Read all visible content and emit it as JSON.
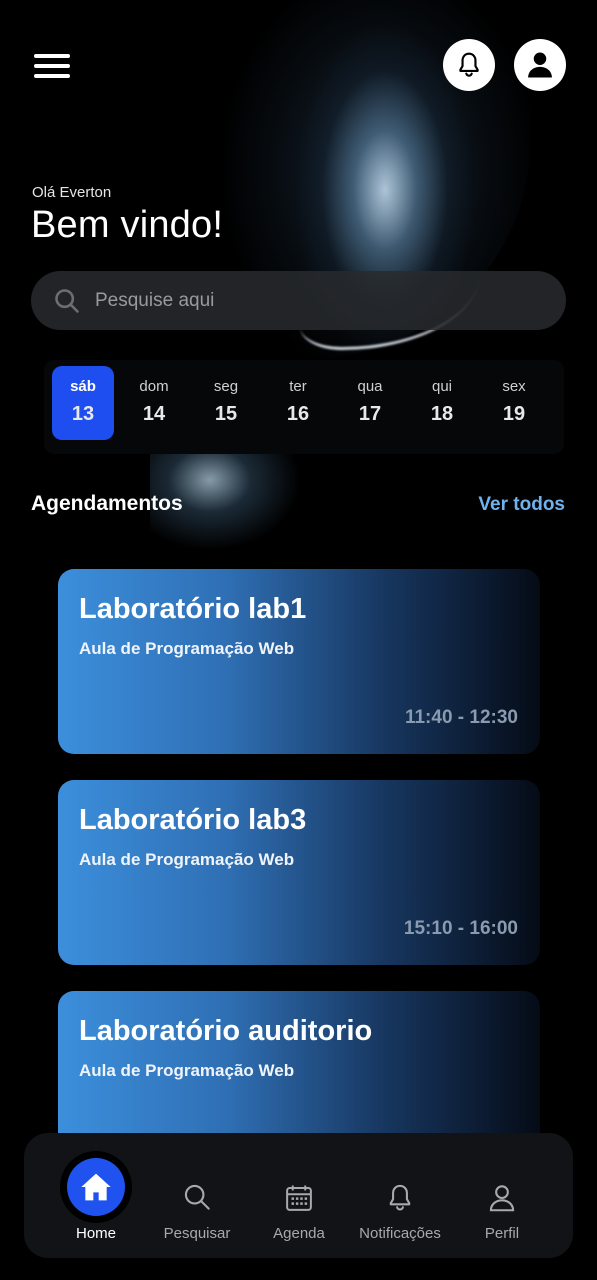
{
  "header": {
    "greeting": "Olá Everton",
    "welcome": "Bem vindo!"
  },
  "search": {
    "placeholder": "Pesquise aqui"
  },
  "calendar": {
    "days": [
      {
        "name": "sáb",
        "num": "13",
        "selected": true
      },
      {
        "name": "dom",
        "num": "14"
      },
      {
        "name": "seg",
        "num": "15"
      },
      {
        "name": "ter",
        "num": "16"
      },
      {
        "name": "qua",
        "num": "17"
      },
      {
        "name": "qui",
        "num": "18"
      },
      {
        "name": "sex",
        "num": "19"
      }
    ]
  },
  "appointments": {
    "title": "Agendamentos",
    "see_all": "Ver todos",
    "items": [
      {
        "title": "Laboratório lab1",
        "subtitle": "Aula de Programação Web",
        "time": "11:40 - 12:30"
      },
      {
        "title": "Laboratório lab3",
        "subtitle": "Aula de Programação Web",
        "time": "15:10 - 16:00"
      },
      {
        "title": "Laboratório auditorio",
        "subtitle": "Aula de Programação Web",
        "time": ""
      }
    ]
  },
  "nav": {
    "items": [
      {
        "label": "Home",
        "icon": "home-icon",
        "active": true
      },
      {
        "label": "Pesquisar",
        "icon": "search-icon"
      },
      {
        "label": "Agenda",
        "icon": "calendar-icon"
      },
      {
        "label": "Notificações",
        "icon": "bell-icon"
      },
      {
        "label": "Perfil",
        "icon": "user-icon"
      }
    ]
  },
  "colors": {
    "accent": "#1e4ef0",
    "link": "#6fb3ee",
    "card_start": "#3c8fdc",
    "card_end": "#050b16"
  }
}
